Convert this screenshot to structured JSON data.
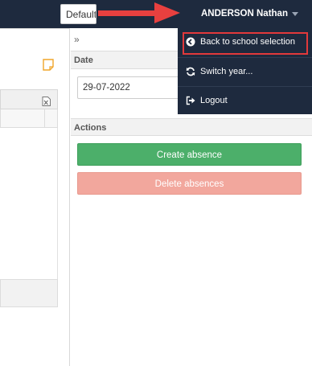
{
  "topbar": {
    "view_select_value": "Default",
    "user_name": "ANDERSON Nathan"
  },
  "user_menu": {
    "items": [
      {
        "label": "Back to school selection",
        "icon": "chevron-circle-left-icon"
      },
      {
        "label": "Switch year...",
        "icon": "refresh-icon"
      },
      {
        "label": "Logout",
        "icon": "sign-out-icon"
      }
    ]
  },
  "side_panel": {
    "collapse_glyph": "»",
    "date_section_title": "Date",
    "date_value": "29-07-2022",
    "actions_section_title": "Actions",
    "create_label": "Create absence",
    "delete_label": "Delete absences"
  },
  "colors": {
    "topbar_bg": "#1e2a3e",
    "create_button": "#4caf6a",
    "delete_button": "#f2a79d",
    "highlight": "#e2393b"
  }
}
